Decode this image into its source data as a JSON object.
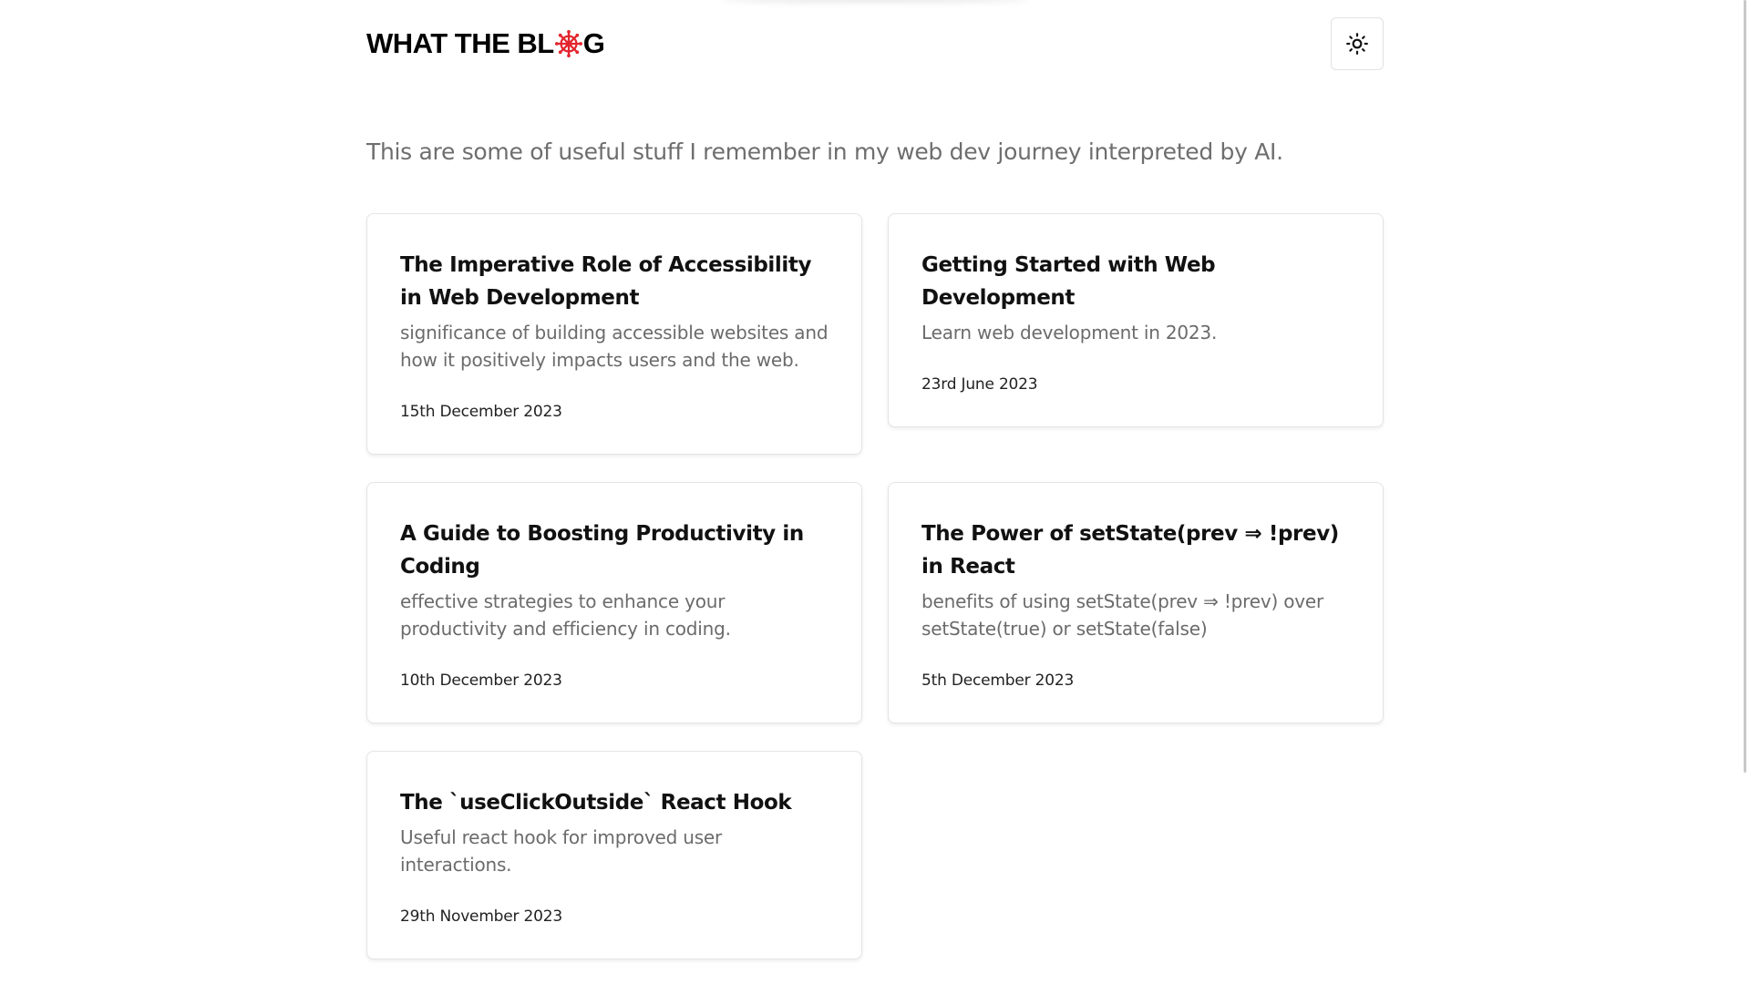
{
  "header": {
    "logo_prefix": "WHAT THE BL",
    "logo_suffix": "G",
    "logo_icon": "dharma-wheel-icon",
    "logo_icon_color": "#e3262e",
    "theme_toggle_icon": "sun-icon"
  },
  "intro": "This are some of useful stuff I remember in my web dev journey interpreted by AI.",
  "posts": [
    {
      "title": "The Imperative Role of Accessibility in Web Development",
      "description": "significance of building accessible websites and how it positively impacts users and the web.",
      "date": "15th December 2023"
    },
    {
      "title": "Getting Started with Web Development",
      "description": "Learn web development in 2023.",
      "date": "23rd June 2023"
    },
    {
      "title": "A Guide to Boosting Productivity in Coding",
      "description": "effective strategies to enhance your productivity and efficiency in coding.",
      "date": "10th December 2023"
    },
    {
      "title": "The Power of setState(prev ⇒ !prev) in React",
      "description": "benefits of using setState(prev ⇒ !prev) over setState(true) or setState(false)",
      "date": "5th December 2023"
    },
    {
      "title": "The `useClickOutside` React Hook",
      "description": "Useful react hook for improved user interactions.",
      "date": "29th November 2023"
    }
  ]
}
